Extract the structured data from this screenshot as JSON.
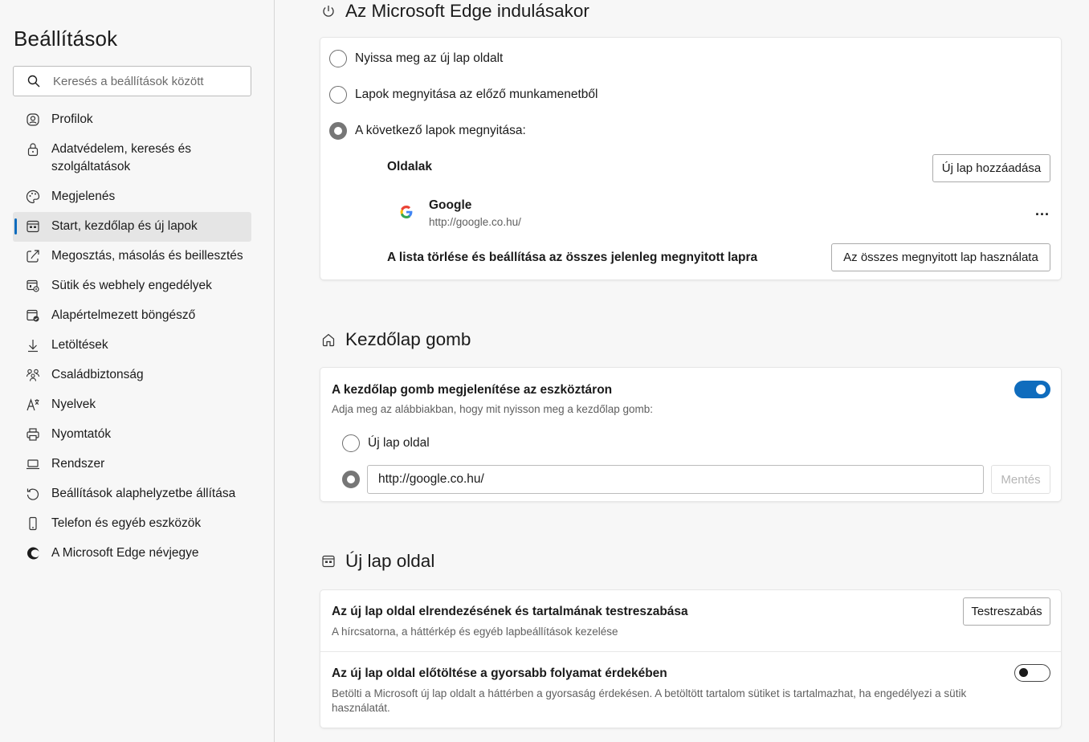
{
  "sidebar": {
    "title": "Beállítások",
    "search_placeholder": "Keresés a beállítások között",
    "items": [
      {
        "label": "Profilok",
        "icon": "profile-icon"
      },
      {
        "label": "Adatvédelem, keresés és szolgáltatások",
        "icon": "lock-icon"
      },
      {
        "label": "Megjelenés",
        "icon": "palette-icon"
      },
      {
        "label": "Start, kezdőlap és új lapok",
        "icon": "start-page-icon",
        "active": true
      },
      {
        "label": "Megosztás, másolás és beillesztés",
        "icon": "share-icon"
      },
      {
        "label": "Sütik és webhely engedélyek",
        "icon": "site-permissions-icon"
      },
      {
        "label": "Alapértelmezett böngésző",
        "icon": "default-browser-icon"
      },
      {
        "label": "Letöltések",
        "icon": "download-icon"
      },
      {
        "label": "Családbiztonság",
        "icon": "family-icon"
      },
      {
        "label": "Nyelvek",
        "icon": "language-icon"
      },
      {
        "label": "Nyomtatók",
        "icon": "printer-icon"
      },
      {
        "label": "Rendszer",
        "icon": "laptop-icon"
      },
      {
        "label": "Beállítások alaphelyzetbe állítása",
        "icon": "reset-icon"
      },
      {
        "label": "Telefon és egyéb eszközök",
        "icon": "phone-icon"
      },
      {
        "label": "A Microsoft Edge névjegye",
        "icon": "edge-logo-icon"
      }
    ]
  },
  "startup": {
    "title": "Az Microsoft Edge indulásakor",
    "options": [
      {
        "label": "Nyissa meg az új lap oldalt",
        "checked": false
      },
      {
        "label": "Lapok megnyitása az előző munkamenetből",
        "checked": false
      },
      {
        "label": "A következő lapok megnyitása:",
        "checked": true
      }
    ],
    "pages_label": "Oldalak",
    "add_button": "Új lap hozzáadása",
    "page": {
      "name": "Google",
      "url": "http://google.co.hu/"
    },
    "more_button": "...",
    "use_all_label": "A lista törlése és beállítása az összes jelenleg megnyitott lapra",
    "use_all_button": "Az összes megnyitott lap használata"
  },
  "home_button": {
    "title": "Kezdőlap gomb",
    "show_label": "A kezdőlap gomb megjelenítése az eszköztáron",
    "show_desc": "Adja meg az alábbiakban, hogy mit nyisson meg a kezdőlap gomb:",
    "toggle_on": true,
    "option_new_tab": "Új lap oldal",
    "url_value": "http://google.co.hu/",
    "save_button": "Mentés"
  },
  "new_tab": {
    "title": "Új lap oldal",
    "customize_label": "Az új lap oldal elrendezésének és tartalmának testreszabása",
    "customize_desc": "A hírcsatorna, a háttérkép és egyéb lapbeállítások kezelése",
    "customize_button": "Testreszabás",
    "preload_label": "Az új lap oldal előtöltése a gyorsabb folyamat érdekében",
    "preload_desc": "Betölti a Microsoft új lap oldalt a háttérben a gyorsaság érdekésen. A betöltött tartalom sütiket is tartalmazhat, ha engedélyezi a sütik használatát.",
    "preload_toggle_on": false
  },
  "colors": {
    "accent": "#0f6cbd",
    "background": "#f7f7f7"
  }
}
